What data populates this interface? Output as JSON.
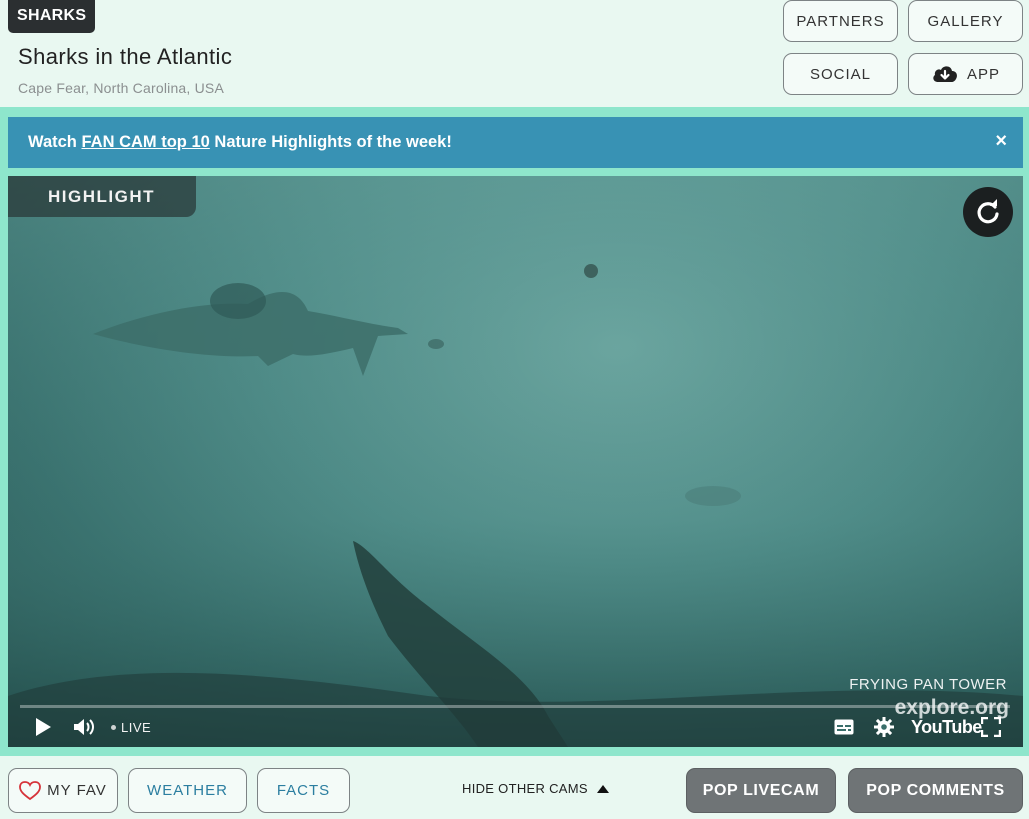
{
  "header": {
    "badge": "SHARKS",
    "title": "Sharks in the Atlantic",
    "location": "Cape Fear, North Carolina, USA",
    "buttons": {
      "partners": "PARTNERS",
      "gallery": "GALLERY",
      "social": "SOCIAL",
      "app": "APP"
    }
  },
  "banner": {
    "prefix": "Watch ",
    "link": "FAN CAM top 10",
    "suffix": " Nature Highlights of the week!",
    "close": "×"
  },
  "player": {
    "highlight_label": "HIGHLIGHT",
    "live_label": "LIVE",
    "cam_name": "FRYING PAN TOWER",
    "brand": "explore.org",
    "youtube": "YouTube",
    "icons": [
      "play-icon",
      "volume-icon",
      "captions-icon",
      "settings-icon",
      "fullscreen-icon",
      "reload-icon"
    ]
  },
  "bottom": {
    "my_fav": "MY FAV",
    "weather": "WEATHER",
    "facts": "FACTS",
    "hide_cams": "HIDE OTHER CAMS",
    "pop_livecam": "POP LIVECAM",
    "pop_comments": "POP COMMENTS"
  },
  "colors": {
    "banner": "#3892b4",
    "accent_band": "#8ee6cc",
    "background": "#e9f8f1",
    "link_text": "#2b7ea0",
    "dark_button": "#6f7476"
  }
}
